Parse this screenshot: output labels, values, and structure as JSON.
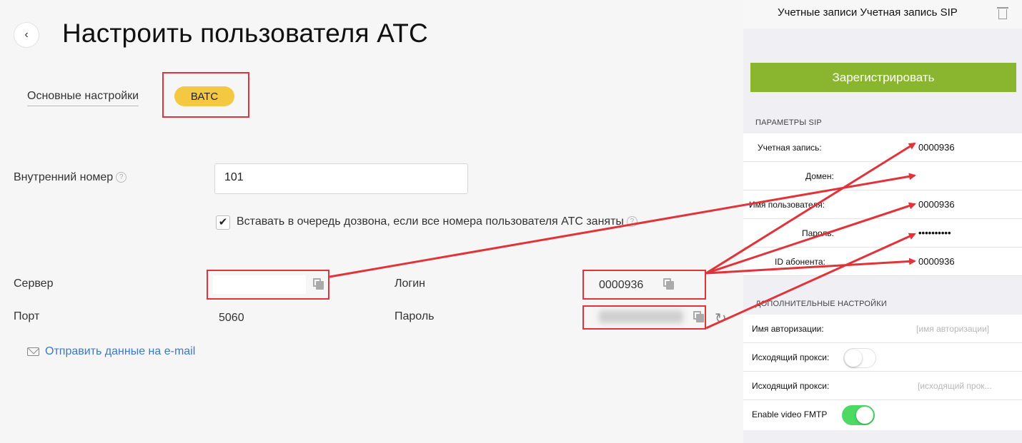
{
  "left": {
    "back_icon": "chevron-left-icon",
    "title": "Настроить пользователя АТС",
    "tabs": {
      "main": "Основные настройки",
      "vats": "ВАТС"
    },
    "ext": {
      "label": "Внутренний номер",
      "value": "101"
    },
    "queue_checkbox": {
      "checked": true,
      "label": "Вставать в очередь дозвона, если все номера пользователя АТС заняты"
    },
    "server": {
      "label": "Сервер",
      "value": ""
    },
    "port": {
      "label": "Порт",
      "value": "5060"
    },
    "login": {
      "label": "Логин",
      "value": "0000936"
    },
    "password": {
      "label": "Пароль"
    },
    "email_link": "Отправить данные на e-mail"
  },
  "right": {
    "header_title": "Учетные записи  Учетная запись SIP",
    "register_button": "Зарегистрировать",
    "sip_section": "ПАРАМЕТРЫ SIP",
    "sip_rows": [
      {
        "label": "Учетная запись:",
        "value": "0000936"
      },
      {
        "label": "Домен:",
        "value": ""
      },
      {
        "label": "Имя пользователя:",
        "value": "0000936"
      },
      {
        "label": "Пароль:",
        "value": "••••••••••"
      },
      {
        "label": "ID абонента:",
        "value": "0000936"
      }
    ],
    "extra_section": "ДОПОЛНИТЕЛЬНЫЕ НАСТРОЙКИ",
    "extra_rows": [
      {
        "label": "Имя авторизации:",
        "placeholder": "[имя авторизации]"
      },
      {
        "label": "Исходящий прокси:",
        "toggle": false
      },
      {
        "label": "Исходящий прокси:",
        "placeholder": "[исходящий прок..."
      },
      {
        "label": "Enable video FMTP",
        "toggle": true
      }
    ]
  },
  "colors": {
    "accent_yellow": "#f5c842",
    "register_green": "#8ab62f",
    "annotation_red": "#e0333a",
    "toggle_on": "#4cd964",
    "link_blue": "#3d78c8"
  }
}
